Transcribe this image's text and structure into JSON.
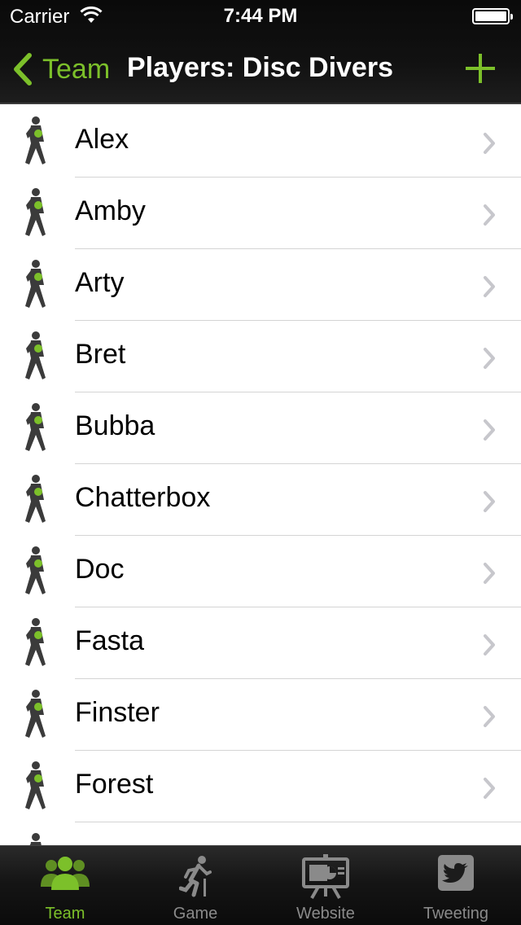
{
  "status_bar": {
    "carrier": "Carrier",
    "time": "7:44 PM",
    "battery": 1.0
  },
  "nav": {
    "back_label": "Team",
    "title": "Players: Disc Divers",
    "add_icon": "plus-icon"
  },
  "players": [
    {
      "name": "Alex"
    },
    {
      "name": "Amby"
    },
    {
      "name": "Arty"
    },
    {
      "name": "Bret"
    },
    {
      "name": "Bubba"
    },
    {
      "name": "Chatterbox"
    },
    {
      "name": "Doc"
    },
    {
      "name": "Fasta"
    },
    {
      "name": "Finster"
    },
    {
      "name": "Forest"
    },
    {
      "name": ""
    }
  ],
  "tabs": [
    {
      "label": "Team",
      "icon": "team-icon",
      "active": true
    },
    {
      "label": "Game",
      "icon": "runner-icon",
      "active": false
    },
    {
      "label": "Website",
      "icon": "website-icon",
      "active": false
    },
    {
      "label": "Tweeting",
      "icon": "twitter-icon",
      "active": false
    }
  ],
  "colors": {
    "accent": "#7cc02a",
    "bar_background": "#111111",
    "tab_inactive": "#8a8a8a",
    "chevron": "#c7c7cc",
    "player_silhouette": "#3b3b3b"
  }
}
